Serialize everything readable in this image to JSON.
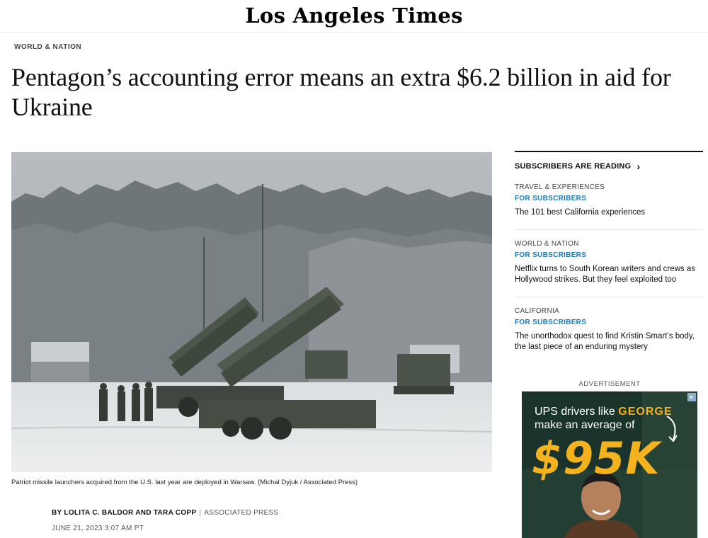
{
  "masthead": {
    "logo_text": "Los Angeles Times"
  },
  "article": {
    "section": "WORLD & NATION",
    "headline": "Pentagon’s accounting error means an extra $6.2 billion in aid for Ukraine",
    "photo": {
      "icon": "photo-patriot-launchers"
    },
    "caption": "Patriot missile launchers acquired from the U.S. last year are deployed in Warsaw. (Michal Dyjuk / Associated Press)",
    "byline": {
      "authors": "BY LOLITA C. BALDOR AND TARA COPP",
      "separator": "|",
      "agency": "ASSOCIATED PRESS"
    },
    "date": "JUNE 21, 2023 3:07 AM PT"
  },
  "rail": {
    "header": "SUBSCRIBERS ARE READING",
    "chevron_icon": "chevron-right-icon",
    "items": [
      {
        "category": "TRAVEL & EXPERIENCES",
        "badge": "FOR SUBSCRIBERS",
        "title": "The 101 best California experiences"
      },
      {
        "category": "WORLD & NATION",
        "badge": "FOR SUBSCRIBERS",
        "title": "Netflix turns to South Korean writers and crews as Hollywood strikes. But they feel exploited too"
      },
      {
        "category": "CALIFORNIA",
        "badge": "FOR SUBSCRIBERS",
        "title": "The unorthodox quest to find Kristin Smart’s body, the last piece of an enduring mystery"
      }
    ]
  },
  "ad": {
    "label": "ADVERTISEMENT",
    "line1_prefix": "UPS drivers like ",
    "line1_name": "GEORGE",
    "line2": "make an average of",
    "amount": "$95K",
    "choices_icon": "adchoices-icon"
  },
  "colors": {
    "accent_blue": "#1a7bb9",
    "ad_yellow": "#f4b21c",
    "ad_bg": "#1a332b"
  }
}
